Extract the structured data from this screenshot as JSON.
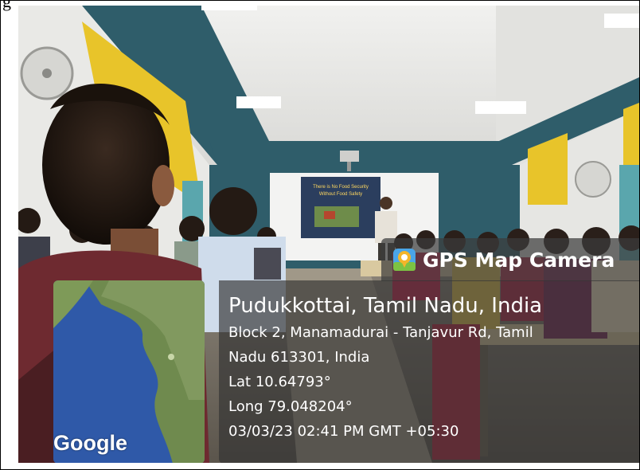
{
  "overlay": {
    "app_name": "GPS Map Camera",
    "map_attribution": "Google",
    "place_title": "Pudukkottai, Tamil Nadu, India",
    "address_line_1": "Block 2, Manamadurai - Tanjavur Rd, Tamil",
    "address_line_2": "Nadu 613301, India",
    "latitude": "Lat 10.64793°",
    "longitude": "Long 79.048204°",
    "datetime": "03/03/23 02:41 PM GMT +05:30"
  },
  "slide": {
    "line_1": "There is No Food Security",
    "line_2": "Without Food Safety"
  },
  "colors": {
    "wall_teal": "#2f5d6a",
    "accent_yellow": "#e8c42a",
    "badge_bg": "#3c3c3c"
  }
}
